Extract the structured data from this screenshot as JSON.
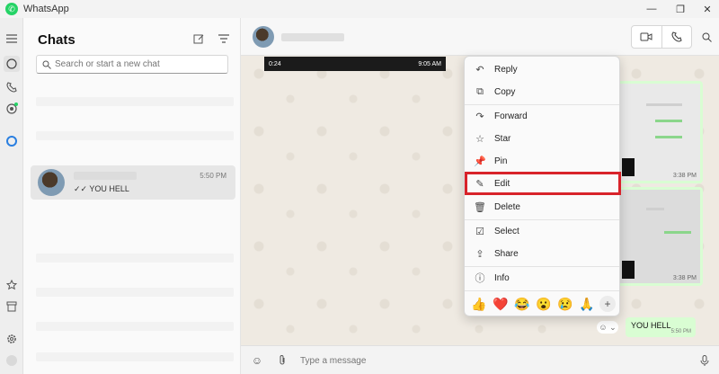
{
  "app": {
    "title": "WhatsApp"
  },
  "window": {
    "minimize": "—",
    "restore": "❐",
    "close": "✕"
  },
  "rail": {
    "icons": [
      "menu-icon",
      "chats-icon",
      "calls-icon",
      "status-icon",
      "meta-ai-icon",
      "starred-icon",
      "archive-icon",
      "settings-icon",
      "profile-icon"
    ]
  },
  "chatlist": {
    "title": "Chats",
    "search_placeholder": "Search or start a new chat",
    "active_chat": {
      "time": "5:50 PM",
      "last_message": "✓✓ YOU HELL"
    }
  },
  "conversation": {
    "video": {
      "duration": "0:24",
      "time": "9:05 AM"
    },
    "images": [
      {
        "time": "3:38 PM"
      },
      {
        "time": "3:38 PM"
      }
    ],
    "message": {
      "text": "YOU HELL",
      "time": "5:50 PM"
    },
    "composer_placeholder": "Type a message"
  },
  "context_menu": {
    "items": [
      {
        "label": "Reply",
        "icon": "reply-icon",
        "glyph": "↶"
      },
      {
        "label": "Copy",
        "icon": "copy-icon",
        "glyph": "⧉"
      },
      {
        "label": "Forward",
        "icon": "forward-icon",
        "glyph": "↷"
      },
      {
        "label": "Star",
        "icon": "star-icon",
        "glyph": "☆"
      },
      {
        "label": "Pin",
        "icon": "pin-icon",
        "glyph": "📌"
      },
      {
        "label": "Edit",
        "icon": "pencil-icon",
        "glyph": "✎"
      },
      {
        "label": "Delete",
        "icon": "trash-icon",
        "glyph": "🗑"
      },
      {
        "label": "Select",
        "icon": "checkbox-icon",
        "glyph": "☑"
      },
      {
        "label": "Share",
        "icon": "share-icon",
        "glyph": "⇪"
      },
      {
        "label": "Info",
        "icon": "info-icon",
        "glyph": "ⓘ"
      }
    ],
    "reactions": [
      "👍",
      "❤️",
      "😂",
      "😮",
      "😢",
      "🙏"
    ],
    "highlight_color": "#d8232a"
  }
}
